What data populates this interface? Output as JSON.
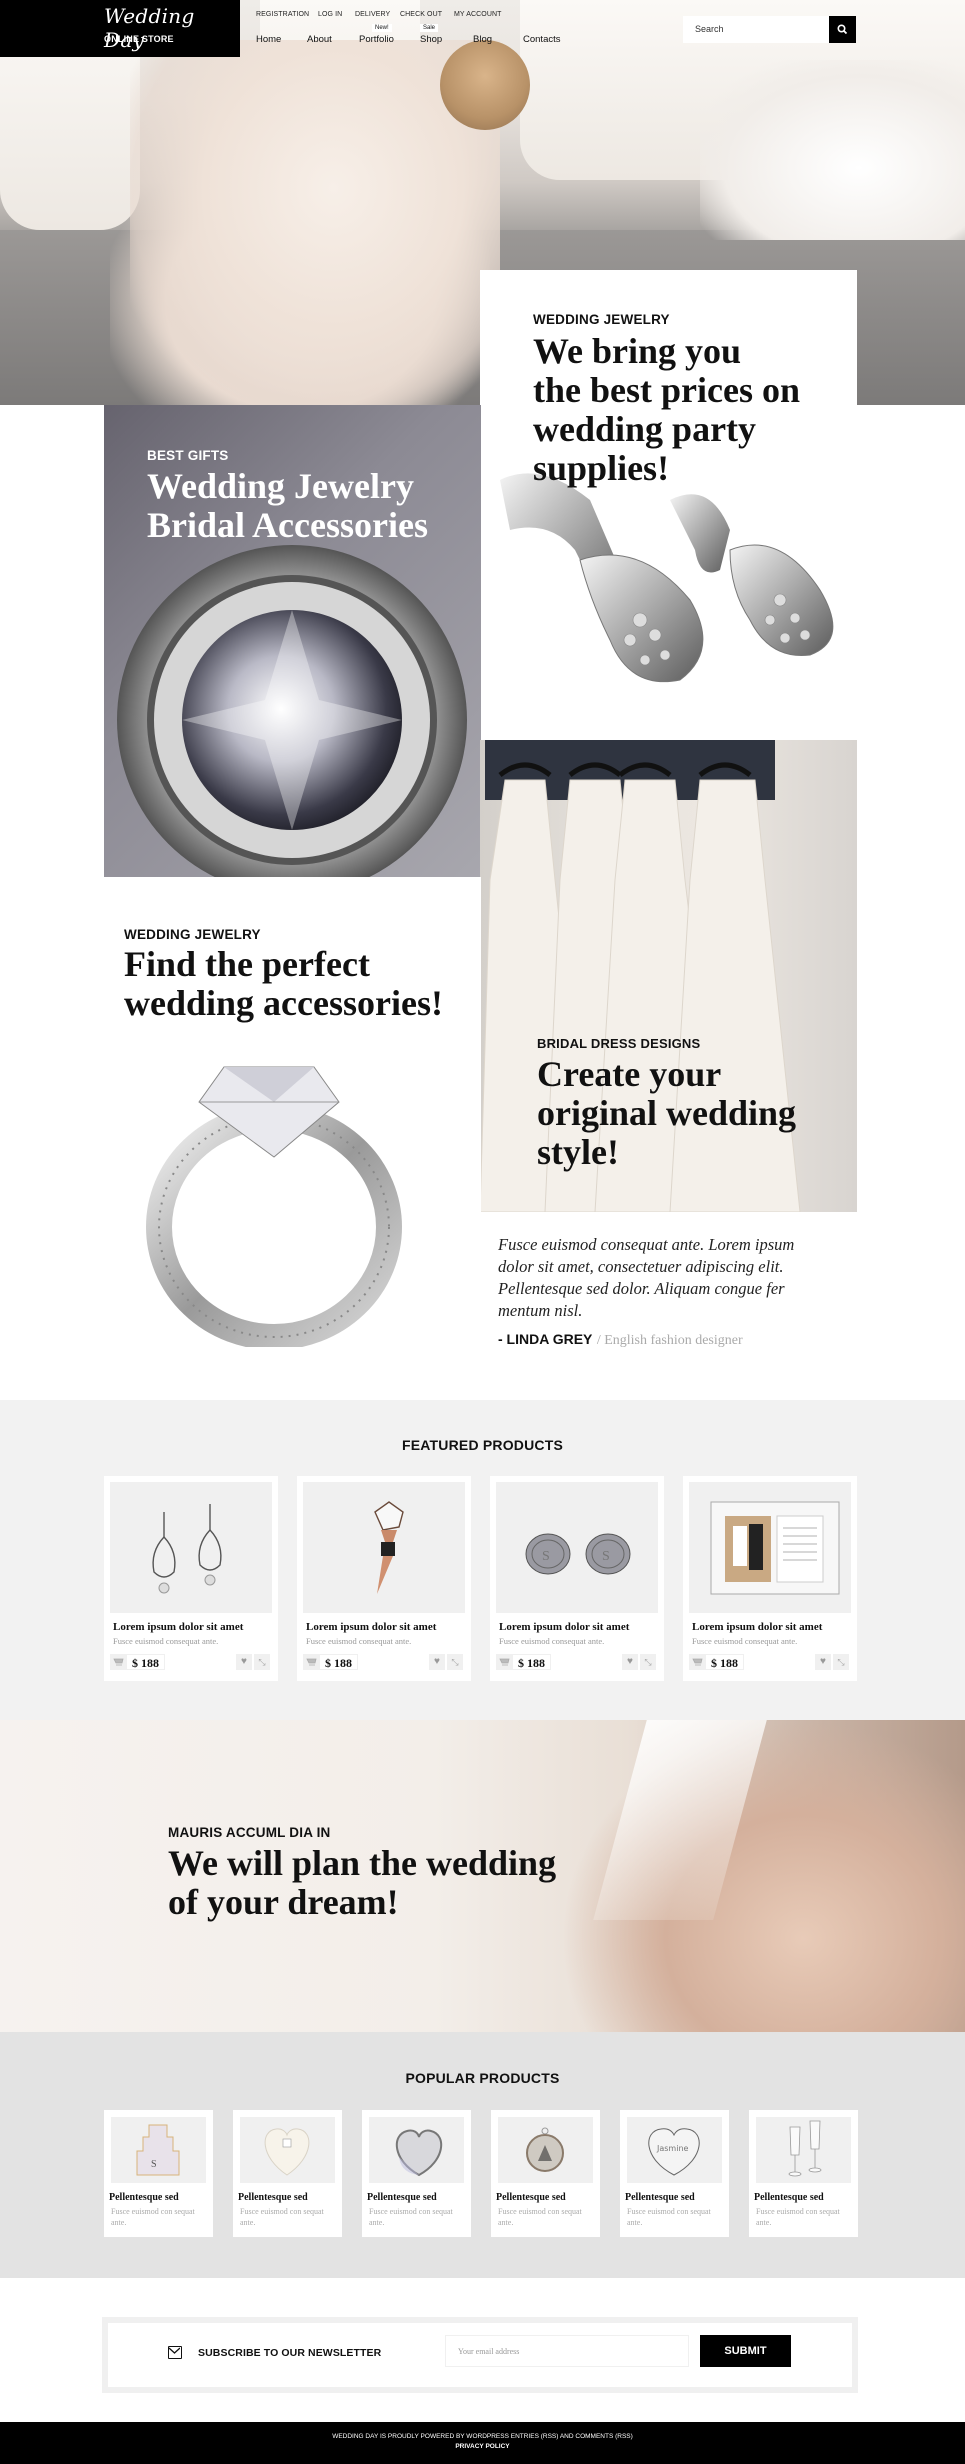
{
  "header": {
    "logo_script": "Wedding Day",
    "logo_sub": "ONLINE STORE",
    "top_links": [
      "REGISTRATION",
      "LOG IN",
      "DELIVERY",
      "CHECK OUT",
      "MY ACCOUNT"
    ],
    "nav": [
      {
        "label": "Home",
        "badge": null
      },
      {
        "label": "About",
        "badge": null
      },
      {
        "label": "Portfolio",
        "badge": "New!"
      },
      {
        "label": "Shop",
        "badge": "Sale"
      },
      {
        "label": "Blog",
        "badge": null
      },
      {
        "label": "Contacts",
        "badge": null
      }
    ],
    "search_placeholder": "Search",
    "search_icon": "search-icon"
  },
  "promos": {
    "prices": {
      "eyebrow": "WEDDING JEWELRY",
      "title_lines": [
        "We bring you",
        "the best prices on",
        "wedding party",
        "supplies!"
      ]
    },
    "gifts": {
      "eyebrow": "BEST GIFTS",
      "title_lines": [
        "Wedding Jewelry",
        "Bridal Accessories"
      ]
    },
    "find": {
      "eyebrow": "WEDDING JEWELRY",
      "title_lines": [
        "Find the perfect",
        "wedding accessories!"
      ]
    },
    "dress": {
      "eyebrow": "BRIDAL DRESS DESIGNS",
      "title_lines": [
        "Create your",
        "original wedding",
        "style!"
      ]
    }
  },
  "testimonial": {
    "quote_lines": [
      "Fusce euismod consequat ante. Lorem ipsum",
      "dolor sit amet, consectetuer adipiscing elit.",
      "Pellentesque sed dolor. Aliquam congue fer",
      "mentum nisl."
    ],
    "author": "- LINDA GREY",
    "role": "/ English fashion designer"
  },
  "featured": {
    "title": "FEATURED PRODUCTS",
    "products": [
      {
        "image": "earrings",
        "title": "Lorem ipsum dolor sit amet",
        "desc": "Fusce euismod consequat ante.",
        "price": "$ 188"
      },
      {
        "image": "bottle-stopper",
        "title": "Lorem ipsum dolor sit amet",
        "desc": "Fusce euismod consequat ante.",
        "price": "$ 188"
      },
      {
        "image": "cufflinks",
        "title": "Lorem ipsum dolor sit amet",
        "desc": "Fusce euismod consequat ante.",
        "price": "$ 188"
      },
      {
        "image": "photo-frame",
        "title": "Lorem ipsum dolor sit amet",
        "desc": "Fusce euismod consequat ante.",
        "price": "$ 188"
      }
    ],
    "icons": {
      "cart": "cart-icon",
      "wishlist": "heart-icon",
      "compare": "compare-icon"
    }
  },
  "banner": {
    "eyebrow": "MAURIS ACCUML DIA IN",
    "title_lines": [
      "We will plan the wedding",
      "of your dream!"
    ]
  },
  "popular": {
    "title": "POPULAR PRODUCTS",
    "products": [
      {
        "image": "cake-cookie",
        "title": "Pellentesque sed",
        "desc": "Fusce euismod con sequat ante."
      },
      {
        "image": "heart-dish",
        "title": "Pellentesque sed",
        "desc": "Fusce euismod con sequat ante."
      },
      {
        "image": "heart-compact",
        "title": "Pellentesque sed",
        "desc": "Fusce euismod con sequat ante."
      },
      {
        "image": "pendant",
        "title": "Pellentesque sed",
        "desc": "Fusce euismod con sequat ante."
      },
      {
        "image": "heart-tag",
        "title": "Pellentesque sed",
        "desc": "Fusce euismod con sequat ante.",
        "engraving": "Jasmine"
      },
      {
        "image": "champagne-flutes",
        "title": "Pellentesque sed",
        "desc": "Fusce euismod con sequat ante."
      }
    ]
  },
  "newsletter": {
    "label": "SUBSCRIBE TO OUR NEWSLETTER",
    "placeholder": "Your email address",
    "submit": "SUBMIT"
  },
  "footer": {
    "line1": "WEDDING DAY IS PROUDLY POWERED BY WORDPRESS ENTRIES (RSS) AND COMMENTS (RSS)",
    "line2": "PRIVACY POLICY"
  },
  "colors": {
    "primary": "#000000",
    "section_gray": "#f2f2f2",
    "popular_gray": "#e3e3e3",
    "muted_text": "#999999"
  }
}
